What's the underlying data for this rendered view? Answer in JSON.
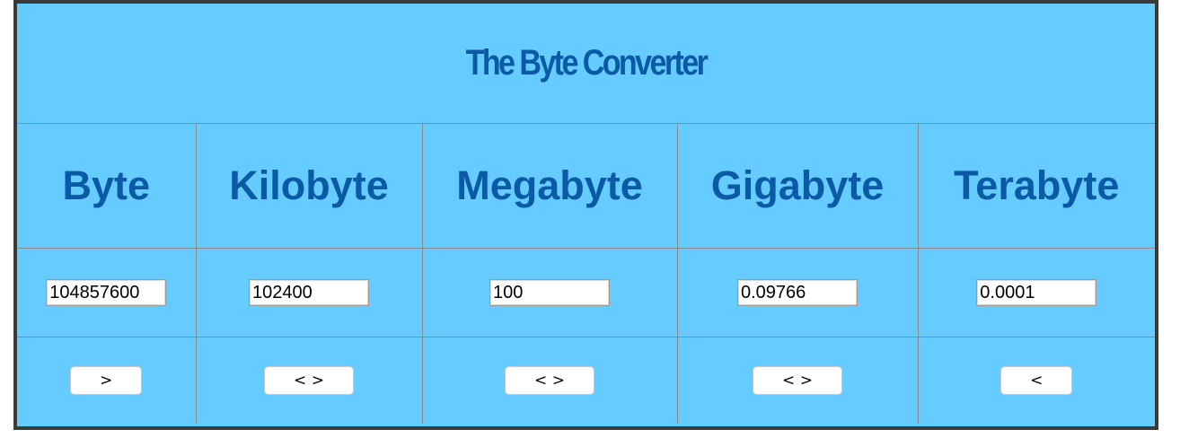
{
  "app": {
    "title": "The Byte Converter"
  },
  "units": [
    {
      "label": "Byte",
      "value": "104857600",
      "button": ">"
    },
    {
      "label": "Kilobyte",
      "value": "102400",
      "button": "< >"
    },
    {
      "label": "Megabyte",
      "value": "100",
      "button": "< >"
    },
    {
      "label": "Gigabyte",
      "value": "0.09766",
      "button": "< >"
    },
    {
      "label": "Terabyte",
      "value": "0.0001",
      "button": "<"
    }
  ],
  "colors": {
    "background": "#66ccff",
    "heading": "#0b5aa6",
    "frame_border": "#3a3a3a",
    "cell_border": "#8a8a8a"
  }
}
